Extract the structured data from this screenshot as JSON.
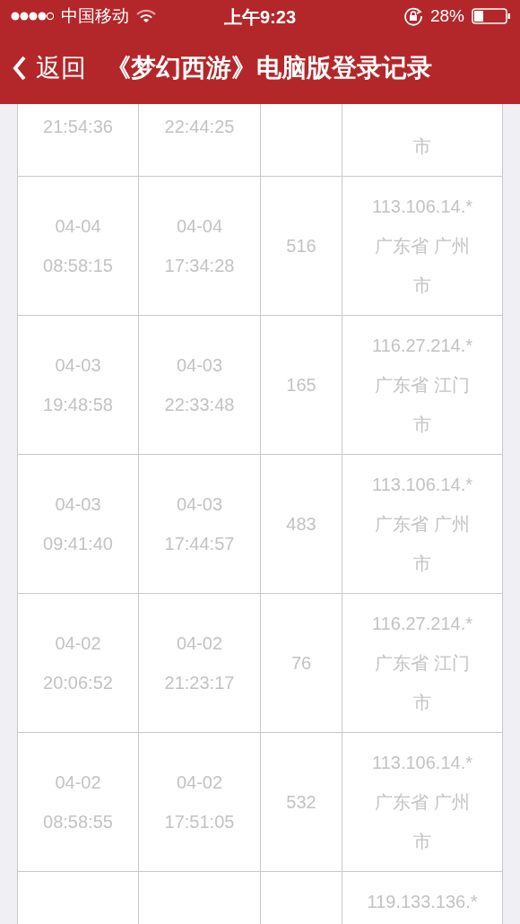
{
  "status_bar": {
    "carrier": "中国移动",
    "time": "上午9:23",
    "battery": "28%"
  },
  "nav": {
    "back": "返回",
    "title": "《梦幻西游》电脑版登录记录"
  },
  "rows": [
    {
      "start_time": "21:54:36",
      "end_time": "22:44:25",
      "location": "市"
    },
    {
      "start_date": "04-04",
      "start_time": "08:58:15",
      "end_date": "04-04",
      "end_time": "17:34:28",
      "duration": "516",
      "ip": "113.106.14.*",
      "location": "广东省 广州市"
    },
    {
      "start_date": "04-03",
      "start_time": "19:48:58",
      "end_date": "04-03",
      "end_time": "22:33:48",
      "duration": "165",
      "ip": "116.27.214.*",
      "location": "广东省 江门市"
    },
    {
      "start_date": "04-03",
      "start_time": "09:41:40",
      "end_date": "04-03",
      "end_time": "17:44:57",
      "duration": "483",
      "ip": "113.106.14.*",
      "location": "广东省 广州市"
    },
    {
      "start_date": "04-02",
      "start_time": "20:06:52",
      "end_date": "04-02",
      "end_time": "21:23:17",
      "duration": "76",
      "ip": "116.27.214.*",
      "location": "广东省 江门市"
    },
    {
      "start_date": "04-02",
      "start_time": "08:58:55",
      "end_date": "04-02",
      "end_time": "17:51:05",
      "duration": "532",
      "ip": "113.106.14.*",
      "location": "广东省 广州市"
    },
    {
      "ip": "119.133.136.*"
    }
  ]
}
